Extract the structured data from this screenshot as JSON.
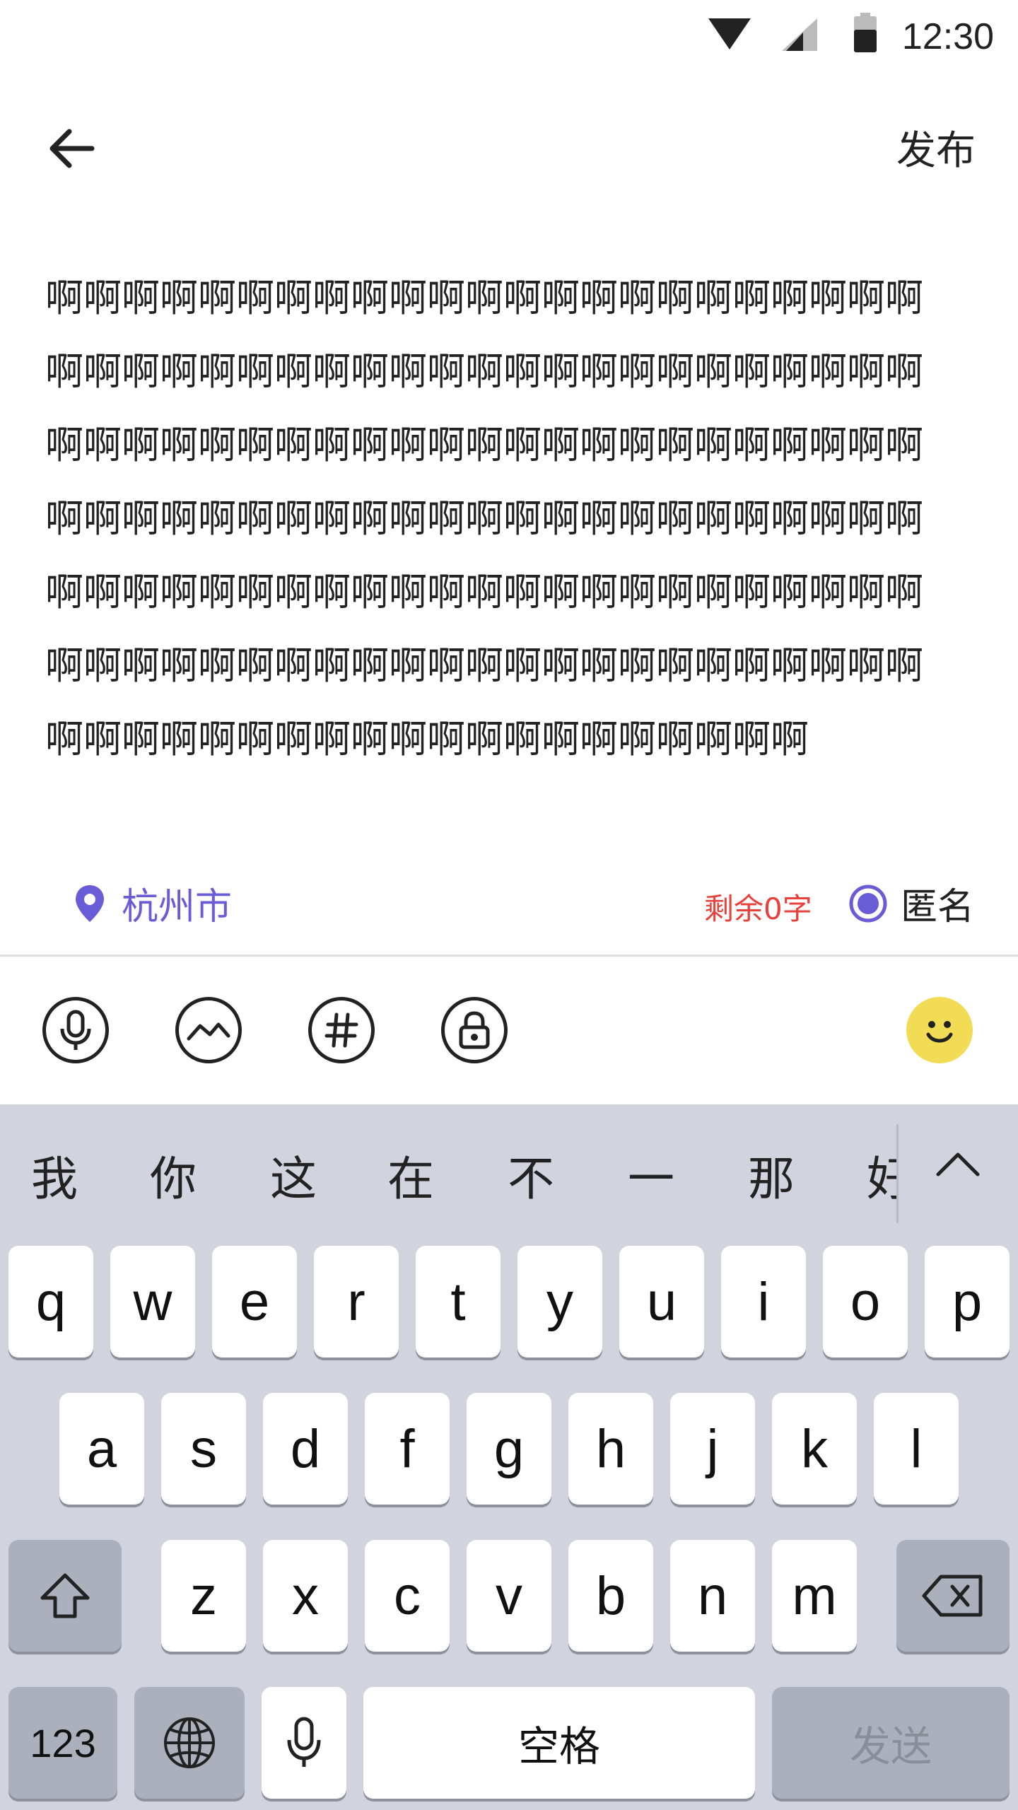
{
  "status_bar": {
    "time": "12:30",
    "icons": [
      "wifi-icon",
      "signal-icon",
      "battery-icon"
    ]
  },
  "header": {
    "back_icon": "arrow-left-icon",
    "publish_label": "发布"
  },
  "post": {
    "text": "啊啊啊啊啊啊啊啊啊啊啊啊啊啊啊啊啊啊啊啊啊啊啊啊啊啊啊啊啊啊啊啊啊啊啊啊啊啊啊啊啊啊啊啊啊啊啊啊啊啊啊啊啊啊啊啊啊啊啊啊啊啊啊啊啊啊啊啊啊啊啊啊啊啊啊啊啊啊啊啊啊啊啊啊啊啊啊啊啊啊啊啊啊啊啊啊啊啊啊啊啊啊啊啊啊啊啊啊啊啊啊啊啊啊啊啊啊啊啊啊啊啊啊啊啊啊啊啊啊啊啊啊啊啊啊啊啊啊啊啊啊啊啊啊啊啊啊啊啊啊啊啊啊啊啊啊啊啊"
  },
  "meta": {
    "location": "杭州市",
    "remaining": "剩余0字",
    "anonymous_label": "匿名",
    "anonymous_checked": true
  },
  "toolbar": {
    "tools": [
      "microphone-icon",
      "image-icon",
      "hashtag-icon",
      "lock-icon"
    ],
    "emoji": "smiley-icon"
  },
  "keyboard": {
    "suggestions": [
      "我",
      "你",
      "这",
      "在",
      "不",
      "一",
      "那",
      "好"
    ],
    "row1": [
      "q",
      "w",
      "e",
      "r",
      "t",
      "y",
      "u",
      "i",
      "o",
      "p"
    ],
    "row2": [
      "a",
      "s",
      "d",
      "f",
      "g",
      "h",
      "j",
      "k",
      "l"
    ],
    "row3": [
      "z",
      "x",
      "c",
      "v",
      "b",
      "n",
      "m"
    ],
    "numbers_label": "123",
    "space_label": "空格",
    "send_label": "发送"
  },
  "colors": {
    "accent": "#6a5bd6",
    "warning": "#e8403a",
    "emoji_bg": "#f3dc55",
    "keyboard_bg": "#d1d4df"
  }
}
